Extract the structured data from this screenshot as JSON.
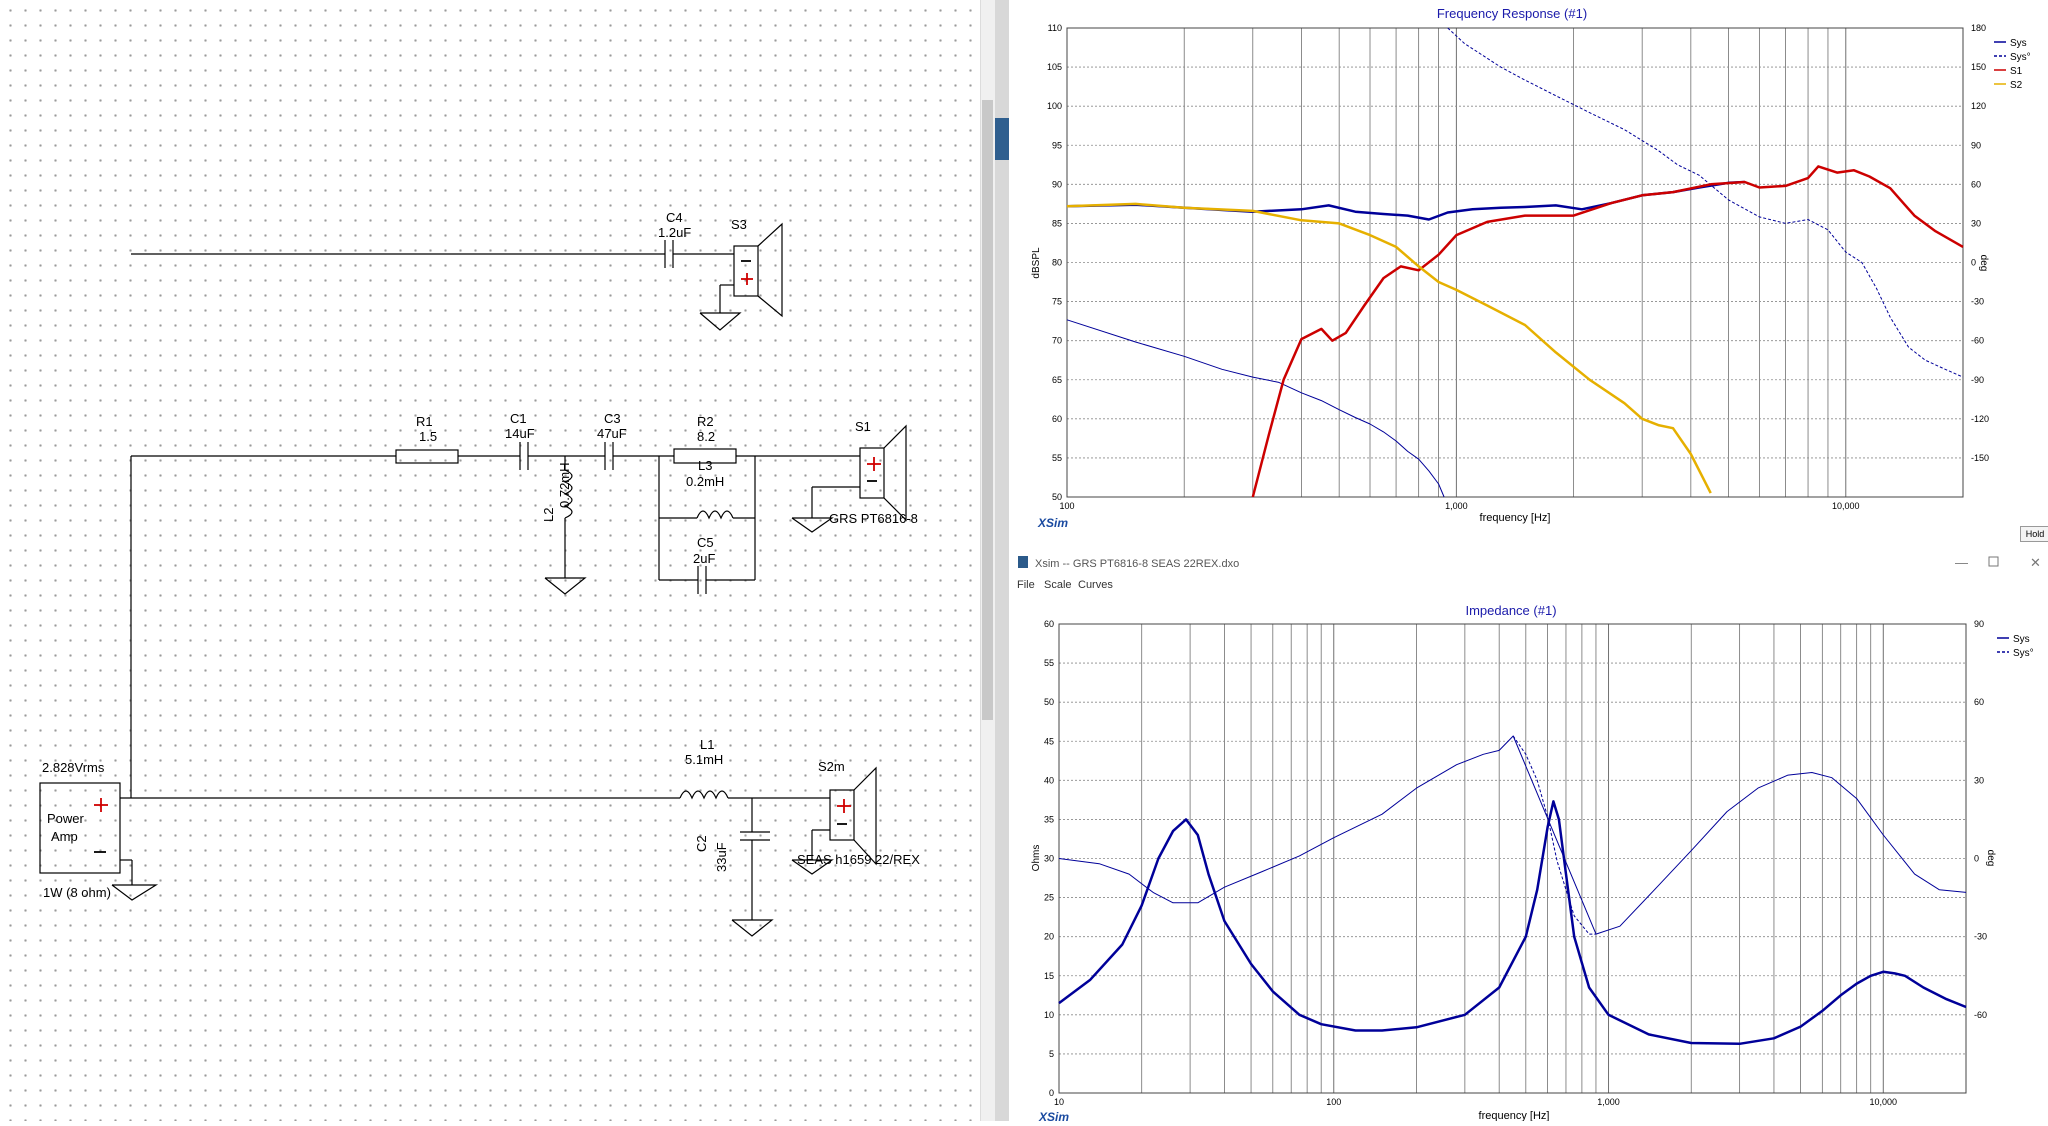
{
  "schematic": {
    "source": {
      "voltage": "2.828Vrms",
      "line1": "Power",
      "line2": "Amp",
      "power": "1W (8 ohm)"
    },
    "components": {
      "c4": {
        "name": "C4",
        "value": "1.2uF"
      },
      "r1": {
        "name": "R1",
        "value": "1.5"
      },
      "c1": {
        "name": "C1",
        "value": "14uF"
      },
      "c3": {
        "name": "C3",
        "value": "47uF"
      },
      "r2": {
        "name": "R2",
        "value": "8.2"
      },
      "l3": {
        "name": "L3",
        "value": "0.2mH"
      },
      "c5": {
        "name": "C5",
        "value": "2uF"
      },
      "l2": {
        "name": "L2",
        "value": "0.72mH"
      },
      "l1": {
        "name": "L1",
        "value": "5.1mH"
      },
      "c2": {
        "name": "C2",
        "value": "33uF"
      }
    },
    "speakers": {
      "s3": {
        "name": "S3",
        "model": ""
      },
      "s1": {
        "name": "S1",
        "model": "GRS PT6816-8"
      },
      "s2m": {
        "name": "S2m",
        "model": "SEAS h1659 22/REX"
      }
    }
  },
  "freq_window": {
    "hold_label": "Hold"
  },
  "imp_window": {
    "title": "Xsim -- GRS PT6816-8 SEAS 22REX.dxo",
    "menu": [
      "File",
      "Scale",
      "Curves"
    ]
  },
  "colors": {
    "sys": "#000099",
    "s1": "#cc0000",
    "s2": "#e6b000",
    "grid": "#606060",
    "title": "#1a1aaa"
  },
  "chart_data": [
    {
      "type": "line",
      "title": "Frequency Response (#1)",
      "xlabel": "frequency [Hz]",
      "ylabel": "dBSPL",
      "y2label": "deg",
      "watermark": "XSim",
      "xscale": "log",
      "xlim": [
        100,
        20000
      ],
      "ylim": [
        50,
        110
      ],
      "y2lim": [
        -180,
        180
      ],
      "xticks": [
        {
          "v": 100,
          "label": "100"
        },
        {
          "v": 1000,
          "label": "1,000"
        },
        {
          "v": 10000,
          "label": "10,000"
        }
      ],
      "yticks": [
        50,
        55,
        60,
        65,
        70,
        75,
        80,
        85,
        90,
        95,
        100,
        105,
        110
      ],
      "y2ticks": [
        -150,
        -120,
        -90,
        -60,
        -30,
        0,
        30,
        60,
        90,
        120,
        150,
        180
      ],
      "legend": [
        "Sys",
        "Sys°",
        "S1",
        "S2"
      ],
      "legend_position": "top-right",
      "series": [
        {
          "name": "Sys",
          "color": "#000099",
          "dash": false,
          "width": 2.5,
          "axis": "left",
          "points": [
            [
              100,
              87.2
            ],
            [
              150,
              87.4
            ],
            [
              200,
              87
            ],
            [
              300,
              86.5
            ],
            [
              400,
              86.8
            ],
            [
              470,
              87.3
            ],
            [
              550,
              86.5
            ],
            [
              650,
              86.2
            ],
            [
              750,
              86
            ],
            [
              850,
              85.5
            ],
            [
              950,
              86.4
            ],
            [
              1100,
              86.8
            ],
            [
              1300,
              87
            ],
            [
              1500,
              87.1
            ],
            [
              1800,
              87.3
            ],
            [
              2100,
              86.8
            ],
            [
              2500,
              87.6
            ],
            [
              3000,
              88.6
            ],
            [
              3600,
              89
            ],
            [
              4200,
              89.6
            ],
            [
              5000,
              90.2
            ],
            [
              5500,
              90.3
            ]
          ]
        },
        {
          "name": "Sys°",
          "color": "#000099",
          "dash": true,
          "width": 1,
          "axis": "right",
          "points": [
            [
              950,
              180
            ],
            [
              1050,
              168
            ],
            [
              1300,
              150
            ],
            [
              1500,
              140
            ],
            [
              1800,
              128
            ],
            [
              2200,
              115
            ],
            [
              2700,
              102
            ],
            [
              3300,
              86
            ],
            [
              3700,
              75
            ],
            [
              4200,
              67
            ],
            [
              5000,
              48
            ],
            [
              6000,
              35
            ],
            [
              7000,
              30
            ],
            [
              8000,
              33
            ],
            [
              9000,
              25
            ],
            [
              10000,
              8
            ],
            [
              11000,
              0
            ],
            [
              12000,
              -20
            ],
            [
              13000,
              -42
            ],
            [
              14500,
              -65
            ],
            [
              16000,
              -75
            ],
            [
              18000,
              -82
            ],
            [
              20000,
              -88
            ]
          ]
        },
        {
          "name": "Sys°",
          "color": "#000099",
          "dash": false,
          "width": 1,
          "axis": "right",
          "points": [
            [
              100,
              -44
            ],
            [
              150,
              -61
            ],
            [
              200,
              -72
            ],
            [
              250,
              -82
            ],
            [
              300,
              -88
            ],
            [
              350,
              -92
            ],
            [
              400,
              -100
            ],
            [
              450,
              -106
            ],
            [
              500,
              -113
            ],
            [
              550,
              -119
            ],
            [
              600,
              -124
            ],
            [
              650,
              -130
            ],
            [
              700,
              -137
            ],
            [
              750,
              -145
            ],
            [
              800,
              -151
            ],
            [
              850,
              -160
            ],
            [
              900,
              -170
            ],
            [
              930,
              -180
            ]
          ]
        },
        {
          "name": "S1",
          "color": "#cc0000",
          "dash": false,
          "width": 2.5,
          "axis": "left",
          "points": [
            [
              300,
              50
            ],
            [
              330,
              58
            ],
            [
              360,
              65
            ],
            [
              400,
              70.2
            ],
            [
              450,
              71.5
            ],
            [
              480,
              70
            ],
            [
              520,
              71
            ],
            [
              580,
              74.5
            ],
            [
              650,
              78
            ],
            [
              720,
              79.5
            ],
            [
              800,
              79
            ],
            [
              900,
              81
            ],
            [
              1000,
              83.5
            ],
            [
              1200,
              85.2
            ],
            [
              1500,
              86
            ],
            [
              2000,
              86
            ],
            [
              2500,
              87.6
            ],
            [
              3000,
              88.6
            ],
            [
              3600,
              89
            ],
            [
              4500,
              90
            ],
            [
              5500,
              90.3
            ],
            [
              6000,
              89.6
            ],
            [
              7000,
              89.8
            ],
            [
              8000,
              90.8
            ],
            [
              8500,
              92.3
            ],
            [
              9500,
              91.5
            ],
            [
              10500,
              91.8
            ],
            [
              11500,
              91
            ],
            [
              13000,
              89.5
            ],
            [
              15000,
              86
            ],
            [
              17000,
              84
            ],
            [
              20000,
              82
            ]
          ]
        },
        {
          "name": "S2",
          "color": "#e6b000",
          "dash": false,
          "width": 2.5,
          "axis": "left",
          "points": [
            [
              100,
              87.2
            ],
            [
              150,
              87.5
            ],
            [
              200,
              87
            ],
            [
              300,
              86.6
            ],
            [
              400,
              85.4
            ],
            [
              500,
              85
            ],
            [
              600,
              83.5
            ],
            [
              700,
              82
            ],
            [
              800,
              79.5
            ],
            [
              900,
              77.5
            ],
            [
              1000,
              76.5
            ],
            [
              1200,
              74.5
            ],
            [
              1500,
              72
            ],
            [
              1800,
              68.5
            ],
            [
              2200,
              65
            ],
            [
              2700,
              62
            ],
            [
              3000,
              60
            ],
            [
              3300,
              59.2
            ],
            [
              3600,
              58.8
            ],
            [
              4000,
              55.5
            ],
            [
              4500,
              50.5
            ]
          ]
        }
      ]
    },
    {
      "type": "line",
      "title": "Impedance (#1)",
      "xlabel": "frequency [Hz]",
      "ylabel": "Ohms",
      "y2label": "deg",
      "watermark": "XSim",
      "xscale": "log",
      "xlim": [
        10,
        20000
      ],
      "ylim": [
        0,
        60
      ],
      "y2lim": [
        -90,
        90
      ],
      "xticks": [
        {
          "v": 10,
          "label": "10"
        },
        {
          "v": 100,
          "label": "100"
        },
        {
          "v": 1000,
          "label": "1,000"
        },
        {
          "v": 10000,
          "label": "10,000"
        }
      ],
      "yticks": [
        0,
        5,
        10,
        15,
        20,
        25,
        30,
        35,
        40,
        45,
        50,
        55,
        60
      ],
      "y2ticks": [
        -60,
        -30,
        0,
        30,
        60,
        90
      ],
      "legend": [
        "Sys",
        "Sys°"
      ],
      "legend_position": "top-right",
      "series": [
        {
          "name": "Sys",
          "color": "#000099",
          "dash": false,
          "width": 2.5,
          "axis": "left",
          "points": [
            [
              10,
              11.5
            ],
            [
              13,
              14.5
            ],
            [
              17,
              19
            ],
            [
              20,
              24
            ],
            [
              23,
              30
            ],
            [
              26,
              33.5
            ],
            [
              29,
              35
            ],
            [
              32,
              33
            ],
            [
              35,
              28
            ],
            [
              40,
              22
            ],
            [
              50,
              16.5
            ],
            [
              60,
              13
            ],
            [
              75,
              10
            ],
            [
              90,
              8.8
            ],
            [
              120,
              8
            ],
            [
              150,
              8
            ],
            [
              200,
              8.4
            ],
            [
              300,
              10
            ],
            [
              400,
              13.5
            ],
            [
              500,
              20
            ],
            [
              550,
              26
            ],
            [
              600,
              34
            ],
            [
              630,
              37.3
            ],
            [
              660,
              35
            ],
            [
              700,
              28
            ],
            [
              750,
              20
            ],
            [
              850,
              13.5
            ],
            [
              1000,
              10
            ],
            [
              1400,
              7.5
            ],
            [
              2000,
              6.4
            ],
            [
              3000,
              6.3
            ],
            [
              4000,
              7
            ],
            [
              5000,
              8.5
            ],
            [
              6000,
              10.5
            ],
            [
              7000,
              12.5
            ],
            [
              8000,
              14
            ],
            [
              9000,
              15
            ],
            [
              10000,
              15.5
            ],
            [
              11000,
              15.3
            ],
            [
              12000,
              15
            ],
            [
              14000,
              13.5
            ],
            [
              17000,
              12
            ],
            [
              20000,
              11
            ]
          ]
        },
        {
          "name": "Sys°",
          "color": "#000099",
          "dash": true,
          "width": 1,
          "axis": "right",
          "points": [
            [
              450,
              47
            ],
            [
              500,
              40
            ],
            [
              550,
              30
            ],
            [
              600,
              16
            ],
            [
              650,
              -1
            ],
            [
              700,
              -12
            ],
            [
              750,
              -22
            ],
            [
              850,
              -29
            ],
            [
              900,
              -29
            ]
          ]
        },
        {
          "name": "Sys°",
          "color": "#000099",
          "dash": false,
          "width": 1,
          "axis": "right",
          "points": [
            [
              10,
              0
            ],
            [
              14,
              -2
            ],
            [
              18,
              -6
            ],
            [
              22,
              -13
            ],
            [
              26,
              -17
            ],
            [
              32,
              -17
            ],
            [
              40,
              -11
            ],
            [
              55,
              -5
            ],
            [
              75,
              1
            ],
            [
              100,
              8
            ],
            [
              150,
              17
            ],
            [
              200,
              27
            ],
            [
              280,
              36
            ],
            [
              350,
              40
            ],
            [
              400,
              41.5
            ],
            [
              450,
              47
            ],
            [
              900,
              -29
            ],
            [
              1100,
              -26
            ],
            [
              1500,
              -11
            ],
            [
              2000,
              3
            ],
            [
              2700,
              18
            ],
            [
              3500,
              27
            ],
            [
              4500,
              32
            ],
            [
              5500,
              33
            ],
            [
              6500,
              31
            ],
            [
              8000,
              23
            ],
            [
              10000,
              9
            ],
            [
              13000,
              -6
            ],
            [
              16000,
              -12
            ],
            [
              20000,
              -13
            ]
          ]
        }
      ]
    }
  ]
}
